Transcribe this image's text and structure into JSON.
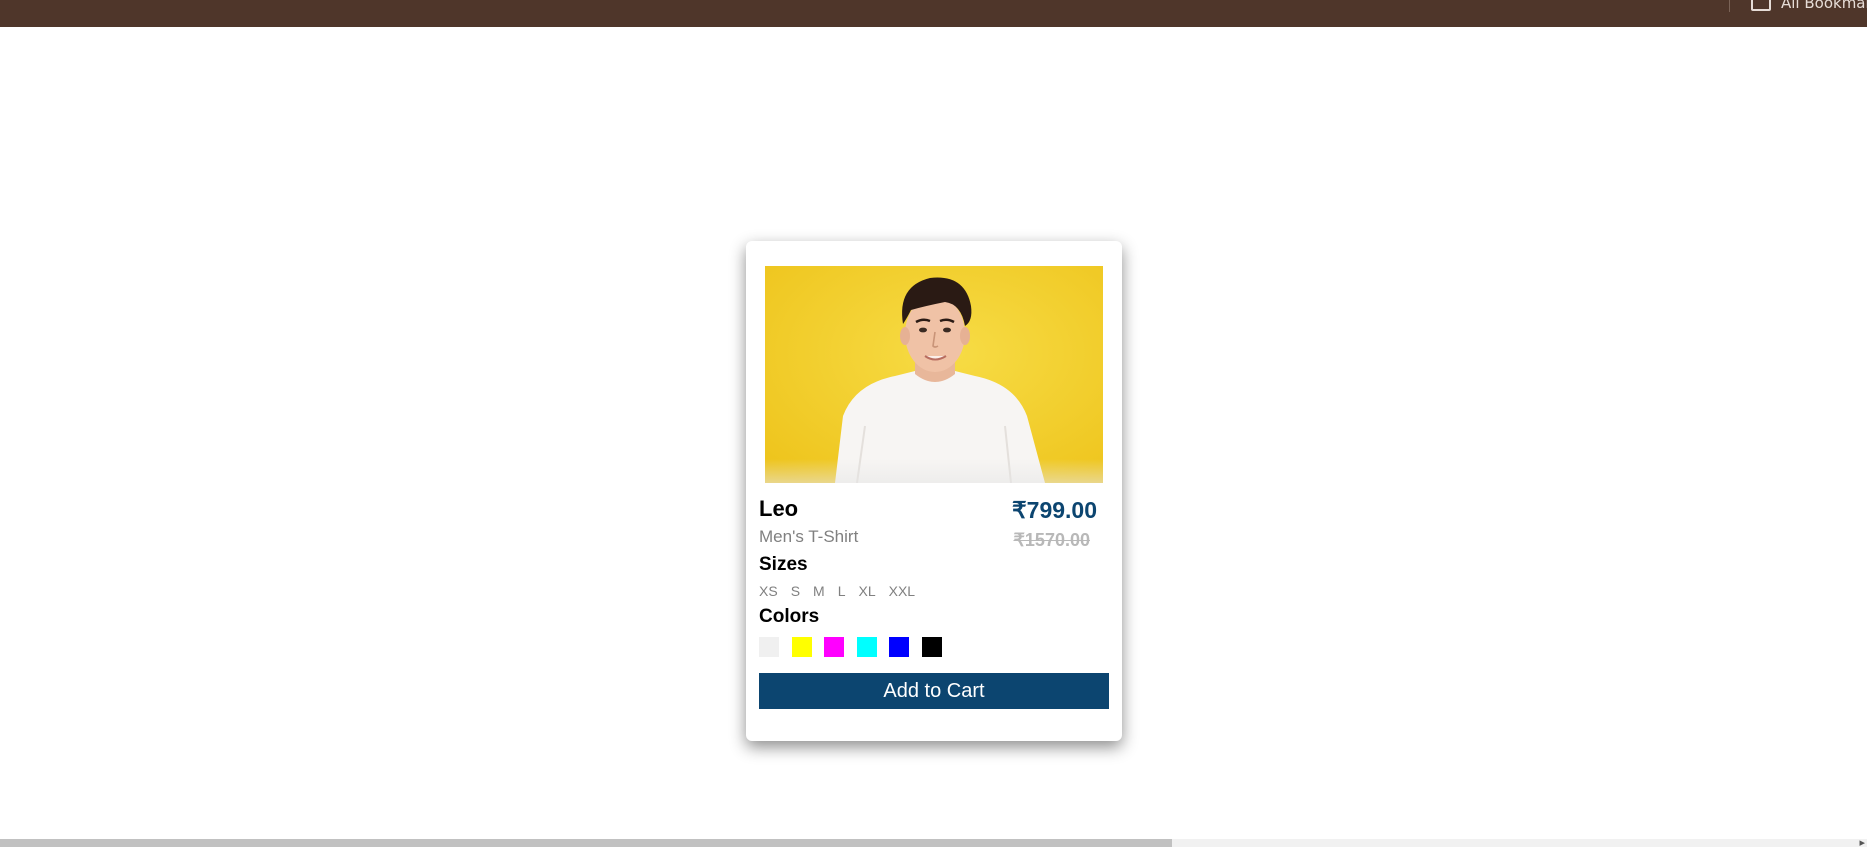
{
  "browser": {
    "bookmarks_label": "All Bookmarks"
  },
  "product": {
    "name": "Leo",
    "subtitle": "Men's T-Shirt",
    "price": "₹799.00",
    "original_price": "₹1570.00",
    "image_alt": "man-in-white-tshirt-photo",
    "sizes_title": "Sizes",
    "sizes": [
      "XS",
      "S",
      "M",
      "L",
      "XL",
      "XXL"
    ],
    "colors_title": "Colors",
    "colors": [
      "#f0f0f0",
      "#ffff00",
      "#ff00ff",
      "#00ffff",
      "#0000ff",
      "#000000"
    ],
    "cta_label": "Add to Cart"
  },
  "theme": {
    "accent": "#0c4570",
    "topbar": "#4f362a"
  }
}
